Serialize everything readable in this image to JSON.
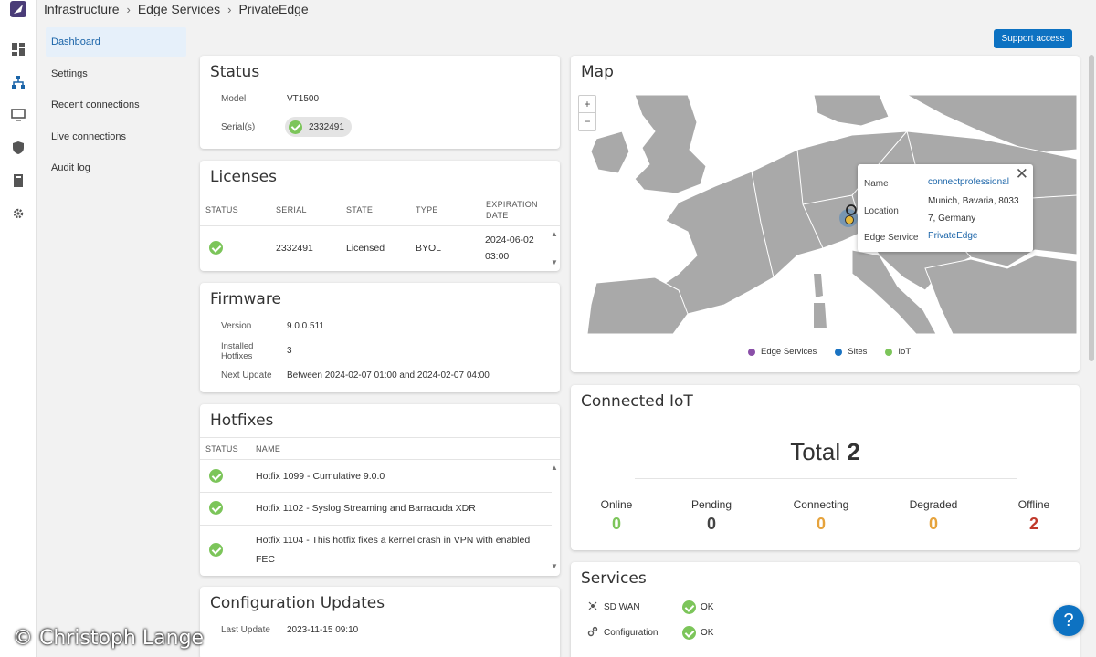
{
  "breadcrumb": [
    "Infrastructure",
    "Edge Services",
    "PrivateEdge"
  ],
  "nav": [
    {
      "label": "Dashboard",
      "active": true
    },
    {
      "label": "Settings",
      "active": false
    },
    {
      "label": "Recent connections",
      "active": false
    },
    {
      "label": "Live connections",
      "active": false
    },
    {
      "label": "Audit log",
      "active": false
    }
  ],
  "support_button": "Support access",
  "status": {
    "title": "Status",
    "model_label": "Model",
    "model_value": "VT1500",
    "serial_label": "Serial(s)",
    "serial_value": "2332491"
  },
  "licenses": {
    "title": "Licenses",
    "headers": [
      "STATUS",
      "SERIAL",
      "STATE",
      "TYPE",
      "EXPIRATION",
      "DATE"
    ],
    "row": {
      "serial": "2332491",
      "state": "Licensed",
      "type": "BYOL",
      "exp_date": "2024-06-02",
      "exp_time": "03:00"
    }
  },
  "firmware": {
    "title": "Firmware",
    "version_label": "Version",
    "version_value": "9.0.0.511",
    "hotfixes_label_1": "Installed",
    "hotfixes_label_2": "Hotfixes",
    "hotfixes_value": "3",
    "next_label": "Next Update",
    "next_value": "Between 2024-02-07 01:00 and 2024-02-07 04:00"
  },
  "hotfixes": {
    "title": "Hotfixes",
    "headers": [
      "STATUS",
      "NAME"
    ],
    "rows": [
      "Hotfix 1099 - Cumulative 9.0.0",
      "Hotfix 1102 - Syslog Streaming and Barracuda XDR",
      "Hotfix 1104 - This hotfix fixes a kernel crash in VPN with enabled",
      "FEC"
    ]
  },
  "config_updates": {
    "title": "Configuration Updates",
    "last_update_label": "Last Update",
    "last_update_value": "2023-11-15 09:10"
  },
  "map": {
    "title": "Map",
    "zoom_in": "+",
    "zoom_out": "−",
    "popup": {
      "name_label": "Name",
      "name_value": "connectprofessional",
      "location_label": "Location",
      "location_value_1": "Munich, Bavaria, 8033",
      "location_value_2": "7, Germany",
      "edge_label": "Edge Service",
      "edge_value": "PrivateEdge"
    },
    "legend": [
      {
        "label": "Edge Services",
        "color": "#8a4fa8"
      },
      {
        "label": "Sites",
        "color": "#1a73c2"
      },
      {
        "label": "IoT",
        "color": "#7cc55a"
      }
    ]
  },
  "iot": {
    "title": "Connected IoT",
    "total_label": "Total",
    "total_value": "2",
    "stats": [
      {
        "label": "Online",
        "value": "0",
        "color": "#7cc55a"
      },
      {
        "label": "Pending",
        "value": "0",
        "color": "#444444"
      },
      {
        "label": "Connecting",
        "value": "0",
        "color": "#e6a33c"
      },
      {
        "label": "Degraded",
        "value": "0",
        "color": "#e6a33c"
      },
      {
        "label": "Offline",
        "value": "2",
        "color": "#c0392b"
      }
    ]
  },
  "services": {
    "title": "Services",
    "rows": [
      {
        "name": "SD WAN",
        "status": "OK",
        "icon": "sdwan-icon"
      },
      {
        "name": "Configuration",
        "status": "OK",
        "icon": "gears-icon"
      }
    ]
  },
  "watermark": "© Christoph Lange"
}
